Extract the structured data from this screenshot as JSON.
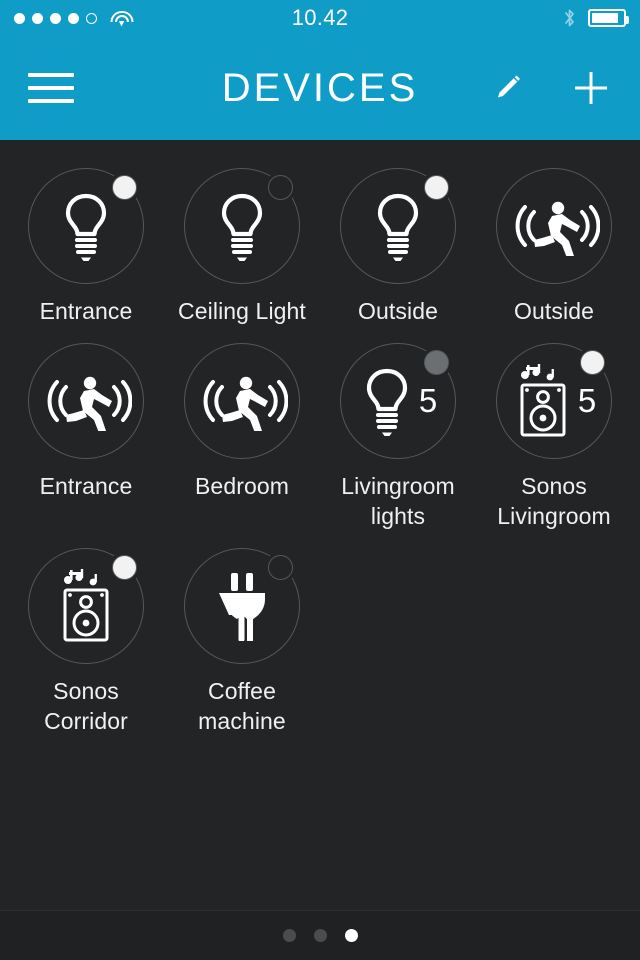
{
  "theme": {
    "accent": "#0f9dc8",
    "background": "#222426",
    "ring": "#55585b",
    "text": "#f0f0f0",
    "status_on": "#f2f2f2",
    "status_dim": "#6c6f72"
  },
  "statusbar": {
    "signal_dots": [
      "filled",
      "filled",
      "filled",
      "filled",
      "hollow"
    ],
    "wifi_icon": "wifi-icon",
    "time": "10.42",
    "bluetooth_icon": "bluetooth-icon",
    "battery_icon": "battery-icon",
    "battery_level": 85
  },
  "navbar": {
    "menu_icon": "hamburger-menu-icon",
    "title": "DEVICES",
    "edit_icon": "pencil-icon",
    "add_icon": "plus-icon"
  },
  "devices": [
    {
      "label": "Entrance",
      "icon": "lightbulb-icon",
      "status": "on",
      "count": ""
    },
    {
      "label": "Ceiling Light",
      "icon": "lightbulb-icon",
      "status": "off",
      "count": ""
    },
    {
      "label": "Outside",
      "icon": "lightbulb-icon",
      "status": "on",
      "count": ""
    },
    {
      "label": "Outside",
      "icon": "motion-sensor-icon",
      "status": "none",
      "count": ""
    },
    {
      "label": "Entrance",
      "icon": "motion-sensor-icon",
      "status": "none",
      "count": ""
    },
    {
      "label": "Bedroom",
      "icon": "motion-sensor-icon",
      "status": "none",
      "count": ""
    },
    {
      "label": "Livingroom lights",
      "icon": "lightbulb-icon",
      "status": "dim",
      "count": "5"
    },
    {
      "label": "Sonos Livingroom",
      "icon": "speaker-icon",
      "status": "on",
      "count": "5"
    },
    {
      "label": "Sonos Corridor",
      "icon": "speaker-icon",
      "status": "on",
      "count": ""
    },
    {
      "label": "Coffee machine",
      "icon": "power-plug-icon",
      "status": "off",
      "count": ""
    }
  ],
  "pager": {
    "total": 3,
    "active_index": 2
  }
}
